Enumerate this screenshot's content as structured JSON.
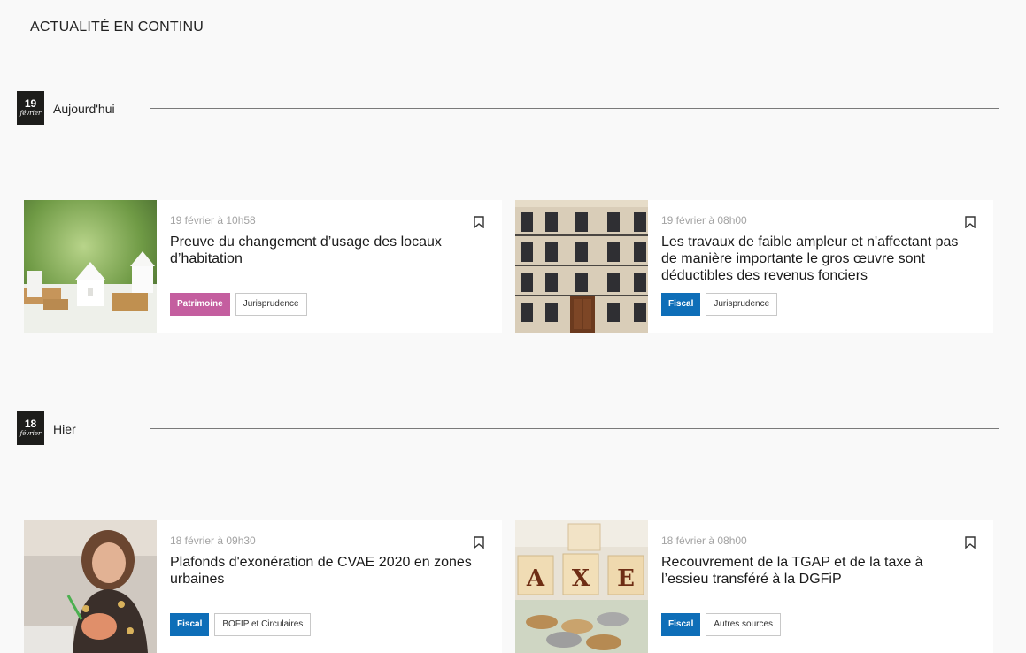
{
  "page": {
    "heading": "ACTUALITÉ EN CONTINU"
  },
  "days": [
    {
      "badge_day": "19",
      "badge_month": "février",
      "label": "Aujourd'hui",
      "articles": [
        {
          "date": "19 février à 10h58",
          "title": "Preuve du changement d’usage des locaux d’habitation",
          "image": "miniature-houses-photo",
          "tags": [
            {
              "label": "Patrimoine",
              "style": "colored",
              "color": "#c45e9f"
            },
            {
              "label": "Jurisprudence",
              "style": "outline"
            }
          ]
        },
        {
          "date": "19 février à 08h00",
          "title": "Les travaux de faible ampleur et n'affectant pas de manière importante le gros œuvre sont déductibles des revenus fonciers",
          "image": "parisian-building-facade-photo",
          "tags": [
            {
              "label": "Fiscal",
              "style": "colored",
              "color": "#0e6eb8"
            },
            {
              "label": "Jurisprudence",
              "style": "outline"
            }
          ]
        }
      ]
    },
    {
      "badge_day": "18",
      "badge_month": "février",
      "label": "Hier",
      "articles": [
        {
          "date": "18 février à 09h30",
          "title": "Plafonds d'exonération de CVAE 2020 en zones urbaines",
          "image": "woman-piggy-bank-photo",
          "tags": [
            {
              "label": "Fiscal",
              "style": "colored",
              "color": "#0e6eb8"
            },
            {
              "label": "BOFIP et Circulaires",
              "style": "outline"
            }
          ]
        },
        {
          "date": "18 février à 08h00",
          "title": "Recouvrement de la TGAP et de la taxe à l’essieu transféré à la DGFiP",
          "image": "tax-wooden-blocks-coins-photo",
          "image_text": "AXE",
          "tags": [
            {
              "label": "Fiscal",
              "style": "colored",
              "color": "#0e6eb8"
            },
            {
              "label": "Autres sources",
              "style": "outline"
            }
          ]
        }
      ]
    }
  ],
  "icons": {
    "bookmark": "bookmark-icon"
  }
}
